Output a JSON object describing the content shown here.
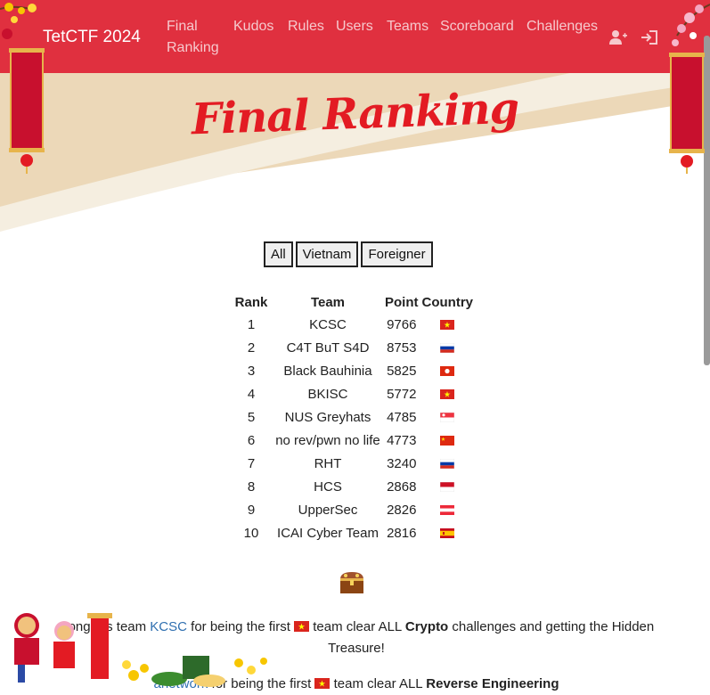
{
  "navbar": {
    "brand": "TetCTF 2024",
    "links": [
      {
        "label": "Final Ranking"
      },
      {
        "label": "Kudos"
      },
      {
        "label": "Rules"
      },
      {
        "label": "Users"
      },
      {
        "label": "Teams"
      },
      {
        "label": "Scoreboard"
      },
      {
        "label": "Challenges"
      }
    ],
    "icons": [
      "register-icon",
      "login-icon"
    ]
  },
  "colors": {
    "navbar": "#e0303f",
    "title": "#e31b23",
    "link": "#2f6fb0"
  },
  "hero": {
    "title": "Final Ranking"
  },
  "filters": [
    {
      "label": "All"
    },
    {
      "label": "Vietnam"
    },
    {
      "label": "Foreigner"
    }
  ],
  "table": {
    "headers": {
      "rank": "Rank",
      "team": "Team",
      "point": "Point",
      "country": "Country"
    },
    "rows": [
      {
        "rank": "1",
        "team": "KCSC",
        "point": "9766",
        "flag": "vietnam-flag-icon"
      },
      {
        "rank": "2",
        "team": "C4T BuT S4D",
        "point": "8753",
        "flag": "russia-flag-icon"
      },
      {
        "rank": "3",
        "team": "Black Bauhinia",
        "point": "5825",
        "flag": "hong-kong-flag-icon"
      },
      {
        "rank": "4",
        "team": "BKISC",
        "point": "5772",
        "flag": "vietnam-flag-icon"
      },
      {
        "rank": "5",
        "team": "NUS Greyhats",
        "point": "4785",
        "flag": "singapore-flag-icon"
      },
      {
        "rank": "6",
        "team": "no rev/pwn no life",
        "point": "4773",
        "flag": "china-flag-icon"
      },
      {
        "rank": "7",
        "team": "RHT",
        "point": "3240",
        "flag": "russia-flag-icon"
      },
      {
        "rank": "8",
        "team": "HCS",
        "point": "2868",
        "flag": "indonesia-flag-icon"
      },
      {
        "rank": "9",
        "team": "UpperSec",
        "point": "2826",
        "flag": "austria-flag-icon"
      },
      {
        "rank": "10",
        "team": "ICAI Cyber Team",
        "point": "2816",
        "flag": "spain-flag-icon"
      }
    ]
  },
  "kudos": [
    {
      "prefix": "Congrats team ",
      "team": "KCSC",
      "mid": " for being the first ",
      "after_flag": " team clear ALL ",
      "category": "Crypto",
      "suffix": " challenges and getting the Hidden Treasure!"
    },
    {
      "team": "anetwork",
      "mid": " for being the first ",
      "after_flag": " team clear ALL ",
      "category": "Reverse Engineering"
    }
  ]
}
